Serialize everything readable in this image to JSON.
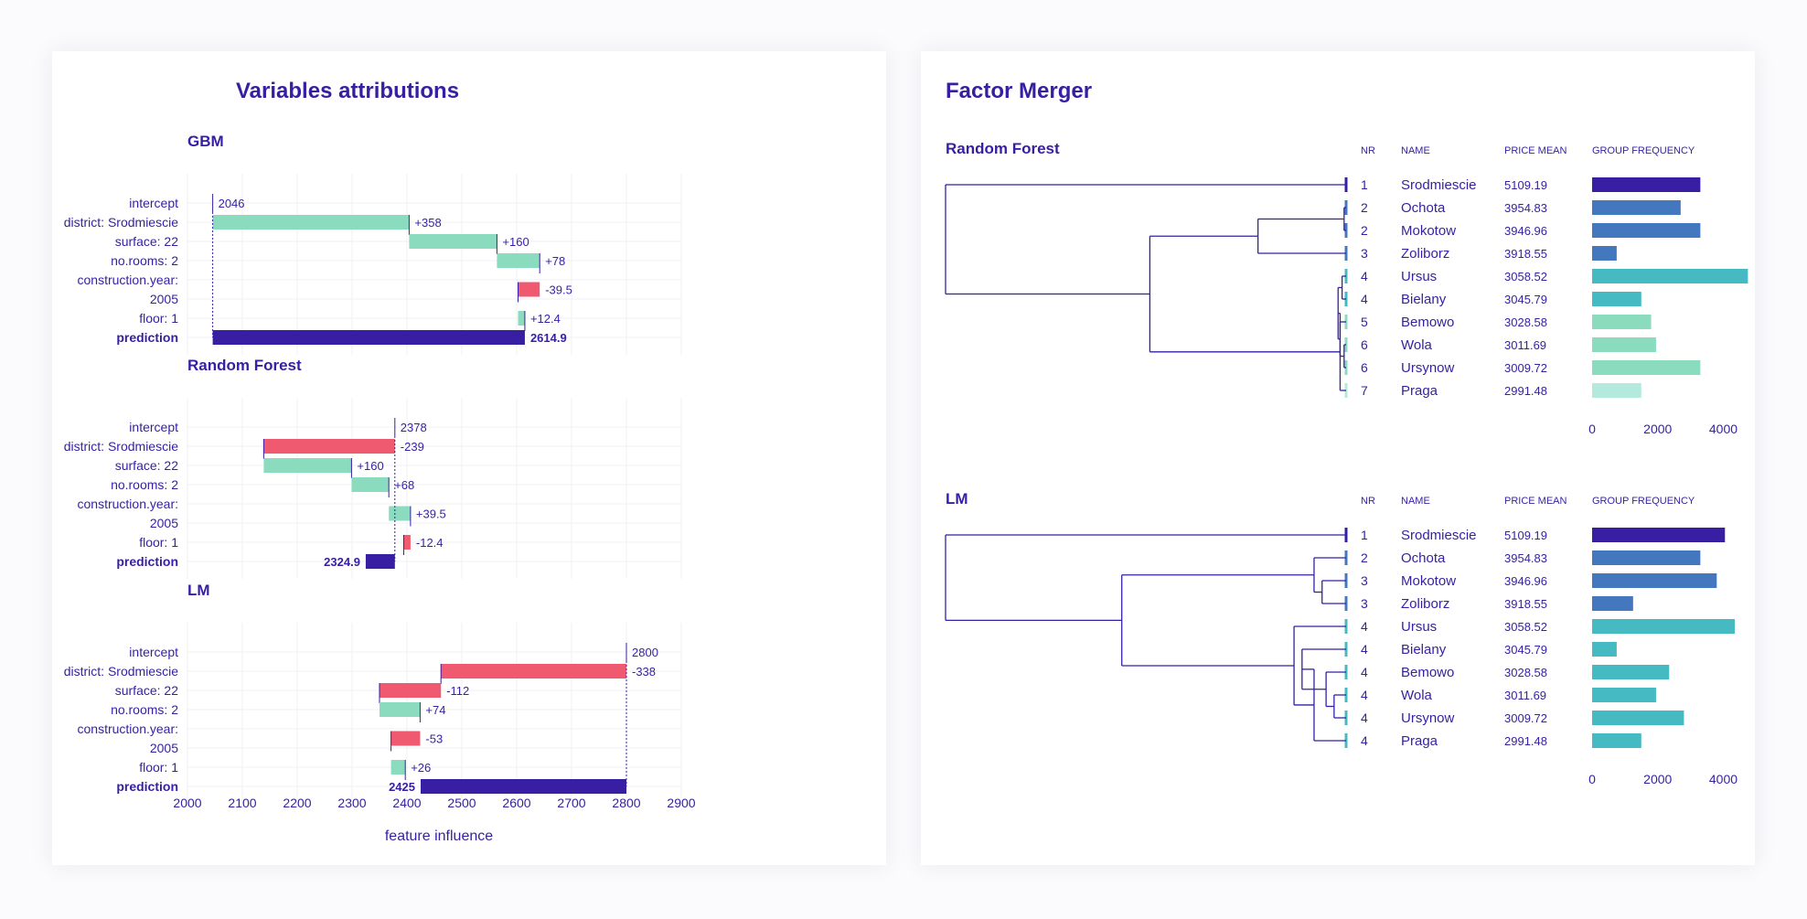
{
  "colors": {
    "primary": "#371ea3",
    "positive": "#8bdcbe",
    "negative": "#f05a71",
    "grid": "#f0f0f4",
    "rf_groups": [
      "#371ea3",
      "#4378bf",
      "#4378bf",
      "#4378bf",
      "#46bac2",
      "#46bac2",
      "#8bdcbe",
      "#8bdcbe",
      "#8bdcbe",
      "#b3eadd"
    ],
    "lm_groups": [
      "#371ea3",
      "#4378bf",
      "#4378bf",
      "#4378bf",
      "#46bac2",
      "#46bac2",
      "#46bac2",
      "#46bac2",
      "#46bac2",
      "#46bac2"
    ]
  },
  "left_panel": {
    "title": "Variables attributions",
    "xlabel": "feature influence",
    "xlim": [
      2000,
      2900
    ],
    "xticks": [
      "2000",
      "2100",
      "2200",
      "2300",
      "2400",
      "2500",
      "2600",
      "2700",
      "2800",
      "2900"
    ],
    "row_labels": [
      "intercept",
      "district: Srodmiescie",
      "surface: 22",
      "no.rooms: 2",
      "construction.year:",
      "2005",
      "floor: 1",
      "prediction"
    ]
  },
  "right_panel": {
    "title": "Factor Merger",
    "col_headers": {
      "nr": "NR",
      "name": "NAME",
      "price_mean": "PRICE MEAN",
      "group_frequency": "GROUP FREQUENCY"
    },
    "freq_ticks": [
      "0",
      "2000",
      "4000"
    ],
    "freq_lim": [
      0,
      4600
    ]
  },
  "chart_data": [
    {
      "type": "waterfall",
      "title": "GBM",
      "intercept": 2046,
      "steps": [
        {
          "variable": "district: Srodmiescie",
          "value": 358,
          "label": "+358"
        },
        {
          "variable": "surface: 22",
          "value": 160,
          "label": "+160"
        },
        {
          "variable": "no.rooms: 2",
          "value": 78,
          "label": "+78"
        },
        {
          "variable": "construction.year: 2005",
          "value": -39.5,
          "label": "-39.5"
        },
        {
          "variable": "floor: 1",
          "value": 12.4,
          "label": "+12.4"
        }
      ],
      "prediction": 2614.9,
      "prediction_label": "2614.9",
      "intercept_label": "2046"
    },
    {
      "type": "waterfall",
      "title": "Random Forest",
      "intercept": 2378,
      "steps": [
        {
          "variable": "district: Srodmiescie",
          "value": -239,
          "label": "-239"
        },
        {
          "variable": "surface: 22",
          "value": 160,
          "label": "+160"
        },
        {
          "variable": "no.rooms: 2",
          "value": 68,
          "label": "+68"
        },
        {
          "variable": "construction.year: 2005",
          "value": 39.5,
          "label": "+39.5"
        },
        {
          "variable": "floor: 1",
          "value": -12.4,
          "label": "-12.4"
        }
      ],
      "prediction": 2324.9,
      "prediction_label": "2324.9",
      "intercept_label": "2378"
    },
    {
      "type": "waterfall",
      "title": "LM",
      "intercept": 2800,
      "steps": [
        {
          "variable": "district: Srodmiescie",
          "value": -338,
          "label": "-338"
        },
        {
          "variable": "surface: 22",
          "value": -112,
          "label": "-112"
        },
        {
          "variable": "no.rooms: 2",
          "value": 74,
          "label": "+74"
        },
        {
          "variable": "construction.year: 2005",
          "value": -53,
          "label": "-53"
        },
        {
          "variable": "floor: 1",
          "value": 26,
          "label": "+26"
        }
      ],
      "prediction": 2425,
      "prediction_label": "2425",
      "intercept_label": "2800"
    },
    {
      "type": "table",
      "title": "Random Forest",
      "rows": [
        {
          "nr": "1",
          "name": "Srodmiescie",
          "price_mean": "5109.19",
          "frequency": 3300
        },
        {
          "nr": "2",
          "name": "Ochota",
          "price_mean": "3954.83",
          "frequency": 2700
        },
        {
          "nr": "2",
          "name": "Mokotow",
          "price_mean": "3946.96",
          "frequency": 3300
        },
        {
          "nr": "3",
          "name": "Zoliborz",
          "price_mean": "3918.55",
          "frequency": 750
        },
        {
          "nr": "4",
          "name": "Ursus",
          "price_mean": "3058.52",
          "frequency": 4750
        },
        {
          "nr": "4",
          "name": "Bielany",
          "price_mean": "3045.79",
          "frequency": 1500
        },
        {
          "nr": "5",
          "name": "Bemowo",
          "price_mean": "3028.58",
          "frequency": 1800
        },
        {
          "nr": "6",
          "name": "Wola",
          "price_mean": "3011.69",
          "frequency": 1950
        },
        {
          "nr": "6",
          "name": "Ursynow",
          "price_mean": "3009.72",
          "frequency": 3300
        },
        {
          "nr": "7",
          "name": "Praga",
          "price_mean": "2991.48",
          "frequency": 1500
        }
      ]
    },
    {
      "type": "table",
      "title": "LM",
      "rows": [
        {
          "nr": "1",
          "name": "Srodmiescie",
          "price_mean": "5109.19",
          "frequency": 4050
        },
        {
          "nr": "2",
          "name": "Ochota",
          "price_mean": "3954.83",
          "frequency": 3300
        },
        {
          "nr": "3",
          "name": "Mokotow",
          "price_mean": "3946.96",
          "frequency": 3800
        },
        {
          "nr": "3",
          "name": "Zoliborz",
          "price_mean": "3918.55",
          "frequency": 1250
        },
        {
          "nr": "4",
          "name": "Ursus",
          "price_mean": "3058.52",
          "frequency": 4350
        },
        {
          "nr": "4",
          "name": "Bielany",
          "price_mean": "3045.79",
          "frequency": 750
        },
        {
          "nr": "4",
          "name": "Bemowo",
          "price_mean": "3028.58",
          "frequency": 2350
        },
        {
          "nr": "4",
          "name": "Wola",
          "price_mean": "3011.69",
          "frequency": 1950
        },
        {
          "nr": "4",
          "name": "Ursynow",
          "price_mean": "3009.72",
          "frequency": 2800
        },
        {
          "nr": "4",
          "name": "Praga",
          "price_mean": "2991.48",
          "frequency": 1500
        }
      ]
    }
  ]
}
